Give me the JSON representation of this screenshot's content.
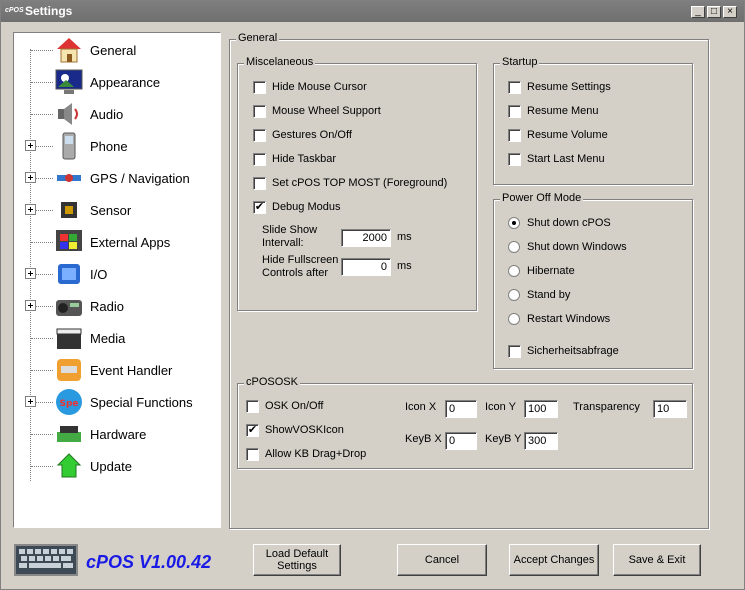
{
  "window": {
    "title": "Settings",
    "app_icon_text": "cPOS"
  },
  "tree": [
    {
      "label": "General",
      "icon": "house-icon",
      "expandable": false
    },
    {
      "label": "Appearance",
      "icon": "monitor-icon",
      "expandable": false
    },
    {
      "label": "Audio",
      "icon": "speaker-icon",
      "expandable": false
    },
    {
      "label": "Phone",
      "icon": "phone-icon",
      "expandable": true
    },
    {
      "label": "GPS / Navigation",
      "icon": "satellite-icon",
      "expandable": true
    },
    {
      "label": "Sensor",
      "icon": "chip-icon",
      "expandable": true
    },
    {
      "label": "External Apps",
      "icon": "windows-icon",
      "expandable": false
    },
    {
      "label": "I/O",
      "icon": "io-icon",
      "expandable": true
    },
    {
      "label": "Radio",
      "icon": "radio-icon",
      "expandable": true
    },
    {
      "label": "Media",
      "icon": "clapper-icon",
      "expandable": false
    },
    {
      "label": "Event Handler",
      "icon": "printer-icon",
      "expandable": false
    },
    {
      "label": "Special Functions",
      "icon": "special-icon",
      "expandable": true
    },
    {
      "label": "Hardware",
      "icon": "hardware-icon",
      "expandable": false
    },
    {
      "label": "Update",
      "icon": "arrow-up-icon",
      "expandable": false
    }
  ],
  "general": {
    "legend": "General",
    "misc": {
      "legend": "Miscelaneous",
      "items": [
        {
          "label": "Hide Mouse Cursor",
          "checked": false
        },
        {
          "label": "Mouse Wheel Support",
          "checked": false
        },
        {
          "label": "Gestures On/Off",
          "checked": false
        },
        {
          "label": "Hide Taskbar",
          "checked": false
        },
        {
          "label": "Set cPOS TOP MOST (Foreground)",
          "checked": false
        },
        {
          "label": "Debug Modus",
          "checked": true
        }
      ],
      "slideshow_label_1": "Slide Show",
      "slideshow_label_2": "Intervall:",
      "slideshow_value": "2000",
      "slideshow_unit": "ms",
      "fullscreen_label_1": "Hide Fullscreen",
      "fullscreen_label_2": "Controls after",
      "fullscreen_value": "0",
      "fullscreen_unit": "ms"
    },
    "startup": {
      "legend": "Startup",
      "items": [
        {
          "label": "Resume Settings",
          "checked": false
        },
        {
          "label": "Resume Menu",
          "checked": false
        },
        {
          "label": "Resume Volume",
          "checked": false
        },
        {
          "label": "Start Last Menu",
          "checked": false
        }
      ]
    },
    "power": {
      "legend": "Power Off Mode",
      "options": [
        {
          "label": "Shut down cPOS",
          "selected": true
        },
        {
          "label": "Shut down Windows",
          "selected": false
        },
        {
          "label": "Hibernate",
          "selected": false
        },
        {
          "label": "Stand by",
          "selected": false
        },
        {
          "label": "Restart Windows",
          "selected": false
        }
      ],
      "confirm_label": "Sicherheitsabfrage"
    },
    "osk": {
      "legend": "cPOSOSK",
      "items": [
        {
          "label": "OSK On/Off",
          "checked": false
        },
        {
          "label": "ShowVOSKIcon",
          "checked": true
        },
        {
          "label": "Allow KB Drag+Drop",
          "checked": false
        }
      ],
      "icon_x_label": "Icon X",
      "icon_x": "0",
      "icon_y_label": "Icon Y",
      "icon_y": "100",
      "transparency_label": "Transparency",
      "transparency": "10",
      "keyb_x_label": "KeyB X",
      "keyb_x": "0",
      "keyb_y_label": "KeyB Y",
      "keyb_y": "300"
    }
  },
  "footer": {
    "version": "cPOS V1.00.42",
    "load_default_1": "Load Default",
    "load_default_2": "Settings",
    "cancel": "Cancel",
    "accept": "Accept Changes",
    "save_exit": "Save & Exit"
  }
}
